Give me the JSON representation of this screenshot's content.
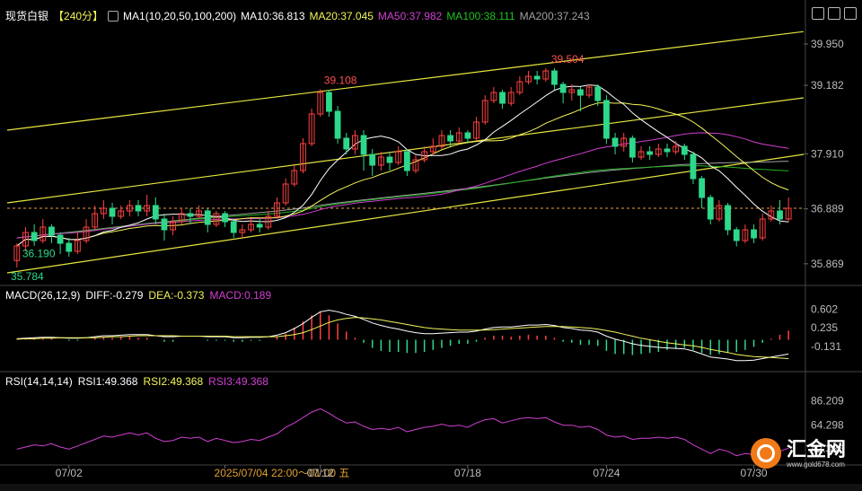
{
  "header": {
    "title": "现货白银",
    "period": "【240分】",
    "ma_label": "MA1(10,20,50,100,200)",
    "ma10": "MA10:36.813",
    "ma20": "MA20:37.045",
    "ma50": "MA50:37.982",
    "ma100": "MA100:38.111",
    "ma200": "MA200:37.243"
  },
  "colors": {
    "up": "#ff4040",
    "down": "#2ed88a",
    "ma10": "#ffffff",
    "ma20": "#f4f45a",
    "ma50": "#d040d0",
    "ma100": "#22b022",
    "ma200": "#a0a0a0",
    "channel": "#e6e640"
  },
  "macd": {
    "label": "MACD(26,12,9)",
    "diff": "DIFF:-0.279",
    "dea": "DEA:-0.373",
    "macd": "MACD:0.189",
    "axis": [
      "0.602",
      "0.235",
      "-0.131"
    ]
  },
  "rsi": {
    "label": "RSI(14,14,14)",
    "rsi1": "RSI1:49.368",
    "rsi2": "RSI2:49.368",
    "rsi3": "RSI3:49.368",
    "axis": [
      "86.209",
      "64.298",
      "42.386"
    ]
  },
  "price_axis": [
    "39.950",
    "39.182",
    "37.910",
    "36.889",
    "35.869"
  ],
  "annotations": {
    "high": "39.504",
    "mid_high": "39.108",
    "low": "36.190",
    "start_low": "35.784"
  },
  "time_axis": [
    "07/02",
    "2025/07/04 22:00～01:00 五",
    "07/12",
    "07/18",
    "07/24",
    "07/30"
  ],
  "logo": {
    "name": "汇金网",
    "url": "www.gold678.com"
  },
  "chart_data": {
    "type": "candlestick",
    "price_ylim": [
      35.5,
      40.3
    ],
    "candles": [
      [
        35.93,
        36.2,
        35.8,
        36.25
      ],
      [
        36.2,
        36.45,
        36.1,
        36.55
      ],
      [
        36.45,
        36.3,
        36.2,
        36.6
      ],
      [
        36.3,
        36.55,
        36.25,
        36.7
      ],
      [
        36.55,
        36.4,
        36.25,
        36.6
      ],
      [
        36.4,
        36.25,
        36.05,
        36.45
      ],
      [
        36.25,
        36.1,
        36.0,
        36.35
      ],
      [
        36.1,
        36.3,
        36.05,
        36.45
      ],
      [
        36.3,
        36.55,
        36.25,
        36.7
      ],
      [
        36.55,
        36.8,
        36.5,
        36.95
      ],
      [
        36.8,
        36.9,
        36.7,
        37.05
      ],
      [
        36.9,
        36.75,
        36.6,
        37.0
      ],
      [
        36.75,
        36.85,
        36.7,
        36.95
      ],
      [
        36.85,
        36.95,
        36.75,
        37.05
      ],
      [
        36.95,
        36.85,
        36.75,
        37.05
      ],
      [
        36.85,
        36.95,
        36.75,
        37.15
      ],
      [
        36.95,
        36.7,
        36.6,
        37.1
      ],
      [
        36.7,
        36.5,
        36.3,
        36.8
      ],
      [
        36.5,
        36.65,
        36.4,
        36.75
      ],
      [
        36.65,
        36.8,
        36.6,
        36.9
      ],
      [
        36.8,
        36.75,
        36.6,
        36.9
      ],
      [
        36.75,
        36.85,
        36.7,
        36.95
      ],
      [
        36.85,
        36.6,
        36.45,
        36.9
      ],
      [
        36.6,
        36.8,
        36.55,
        36.85
      ],
      [
        36.8,
        36.65,
        36.55,
        36.85
      ],
      [
        36.65,
        36.45,
        36.35,
        36.7
      ],
      [
        36.45,
        36.5,
        36.35,
        36.6
      ],
      [
        36.5,
        36.6,
        36.45,
        36.7
      ],
      [
        36.6,
        36.55,
        36.45,
        36.7
      ],
      [
        36.55,
        36.75,
        36.5,
        36.85
      ],
      [
        36.75,
        37.0,
        36.7,
        37.1
      ],
      [
        37.0,
        37.35,
        36.95,
        37.45
      ],
      [
        37.35,
        37.6,
        37.3,
        37.7
      ],
      [
        37.6,
        38.1,
        37.55,
        38.2
      ],
      [
        38.1,
        38.65,
        38.05,
        38.75
      ],
      [
        38.65,
        39.05,
        38.6,
        39.11
      ],
      [
        39.05,
        38.7,
        38.6,
        39.1
      ],
      [
        38.7,
        38.2,
        38.1,
        38.8
      ],
      [
        38.2,
        38.0,
        37.9,
        38.3
      ],
      [
        38.0,
        38.25,
        37.9,
        38.35
      ],
      [
        38.25,
        37.9,
        37.6,
        38.35
      ],
      [
        37.9,
        37.7,
        37.5,
        38.0
      ],
      [
        37.7,
        37.85,
        37.6,
        37.95
      ],
      [
        37.85,
        37.75,
        37.6,
        37.95
      ],
      [
        37.75,
        37.95,
        37.7,
        38.05
      ],
      [
        37.95,
        37.6,
        37.5,
        38.0
      ],
      [
        37.6,
        37.8,
        37.55,
        37.9
      ],
      [
        37.8,
        37.95,
        37.75,
        38.05
      ],
      [
        37.95,
        38.05,
        37.9,
        38.2
      ],
      [
        38.05,
        38.25,
        38.0,
        38.35
      ],
      [
        38.25,
        38.15,
        38.05,
        38.35
      ],
      [
        38.15,
        38.3,
        38.1,
        38.4
      ],
      [
        38.3,
        38.2,
        38.1,
        38.35
      ],
      [
        38.2,
        38.5,
        38.15,
        38.6
      ],
      [
        38.5,
        38.9,
        38.45,
        39.0
      ],
      [
        38.9,
        39.05,
        38.85,
        39.15
      ],
      [
        39.05,
        38.85,
        38.75,
        39.1
      ],
      [
        38.85,
        39.05,
        38.8,
        39.15
      ],
      [
        39.05,
        39.25,
        39.0,
        39.35
      ],
      [
        39.25,
        39.35,
        39.2,
        39.45
      ],
      [
        39.35,
        39.3,
        39.2,
        39.45
      ],
      [
        39.3,
        39.45,
        39.25,
        39.5
      ],
      [
        39.45,
        39.2,
        39.1,
        39.5
      ],
      [
        39.2,
        39.05,
        38.85,
        39.25
      ],
      [
        39.05,
        39.1,
        38.9,
        39.2
      ],
      [
        39.1,
        39.0,
        38.7,
        39.15
      ],
      [
        39.0,
        39.15,
        38.95,
        39.2
      ],
      [
        39.15,
        38.9,
        38.8,
        39.2
      ],
      [
        38.9,
        38.2,
        38.1,
        39.0
      ],
      [
        38.2,
        38.05,
        37.9,
        38.3
      ],
      [
        38.05,
        38.2,
        37.95,
        38.3
      ],
      [
        38.2,
        37.85,
        37.75,
        38.25
      ],
      [
        37.85,
        37.95,
        37.8,
        38.05
      ],
      [
        37.95,
        37.9,
        37.8,
        38.05
      ],
      [
        37.9,
        38.0,
        37.85,
        38.1
      ],
      [
        38.0,
        37.95,
        37.85,
        38.1
      ],
      [
        37.95,
        38.05,
        37.9,
        38.15
      ],
      [
        38.05,
        37.9,
        37.8,
        38.1
      ],
      [
        37.9,
        37.45,
        37.35,
        37.95
      ],
      [
        37.45,
        37.1,
        36.9,
        37.5
      ],
      [
        37.1,
        36.7,
        36.6,
        37.15
      ],
      [
        36.7,
        36.95,
        36.65,
        37.05
      ],
      [
        36.95,
        36.5,
        36.4,
        37.0
      ],
      [
        36.5,
        36.3,
        36.19,
        36.55
      ],
      [
        36.3,
        36.5,
        36.25,
        36.6
      ],
      [
        36.5,
        36.35,
        36.25,
        36.6
      ],
      [
        36.35,
        36.7,
        36.3,
        36.8
      ],
      [
        36.7,
        36.85,
        36.65,
        36.95
      ],
      [
        36.85,
        36.7,
        36.6,
        37.05
      ],
      [
        36.7,
        36.9,
        36.65,
        37.1
      ]
    ],
    "rsi_ylim": [
      30,
      95
    ],
    "rsi_values": [
      42,
      44,
      46,
      45,
      47,
      44,
      42,
      45,
      48,
      51,
      54,
      53,
      55,
      57,
      55,
      57,
      52,
      49,
      50,
      53,
      52,
      53,
      49,
      52,
      50,
      48,
      49,
      51,
      50,
      53,
      56,
      62,
      66,
      71,
      76,
      79,
      75,
      70,
      66,
      67,
      63,
      60,
      61,
      60,
      62,
      58,
      60,
      62,
      63,
      65,
      63,
      64,
      62,
      66,
      69,
      70,
      66,
      68,
      70,
      71,
      70,
      71,
      67,
      64,
      64,
      62,
      63,
      60,
      55,
      53,
      54,
      51,
      52,
      52,
      53,
      52,
      53,
      51,
      46,
      42,
      38,
      42,
      40,
      36,
      38,
      37,
      40,
      42,
      40,
      43
    ],
    "macd_ylim": [
      -0.45,
      0.75
    ],
    "macd_diff": [
      0.02,
      0.03,
      0.04,
      0.05,
      0.05,
      0.04,
      0.03,
      0.03,
      0.04,
      0.06,
      0.08,
      0.08,
      0.09,
      0.1,
      0.1,
      0.1,
      0.08,
      0.06,
      0.06,
      0.07,
      0.07,
      0.07,
      0.06,
      0.06,
      0.06,
      0.04,
      0.04,
      0.05,
      0.05,
      0.06,
      0.09,
      0.14,
      0.22,
      0.32,
      0.44,
      0.55,
      0.58,
      0.55,
      0.5,
      0.46,
      0.4,
      0.33,
      0.28,
      0.24,
      0.21,
      0.17,
      0.14,
      0.12,
      0.12,
      0.13,
      0.14,
      0.15,
      0.15,
      0.17,
      0.21,
      0.24,
      0.25,
      0.25,
      0.27,
      0.29,
      0.29,
      0.3,
      0.28,
      0.24,
      0.22,
      0.19,
      0.18,
      0.15,
      0.07,
      0.01,
      -0.03,
      -0.08,
      -0.11,
      -0.13,
      -0.15,
      -0.16,
      -0.17,
      -0.18,
      -0.22,
      -0.28,
      -0.34,
      -0.36,
      -0.38,
      -0.41,
      -0.41,
      -0.4,
      -0.37,
      -0.34,
      -0.31,
      -0.28
    ],
    "macd_dea": [
      0.01,
      0.02,
      0.02,
      0.03,
      0.03,
      0.04,
      0.04,
      0.04,
      0.04,
      0.04,
      0.05,
      0.06,
      0.06,
      0.07,
      0.08,
      0.08,
      0.08,
      0.08,
      0.08,
      0.07,
      0.07,
      0.07,
      0.07,
      0.07,
      0.07,
      0.06,
      0.06,
      0.06,
      0.06,
      0.06,
      0.06,
      0.08,
      0.1,
      0.14,
      0.2,
      0.27,
      0.34,
      0.39,
      0.42,
      0.44,
      0.43,
      0.41,
      0.39,
      0.36,
      0.33,
      0.3,
      0.27,
      0.24,
      0.22,
      0.21,
      0.2,
      0.19,
      0.19,
      0.19,
      0.19,
      0.2,
      0.21,
      0.22,
      0.23,
      0.24,
      0.25,
      0.26,
      0.26,
      0.26,
      0.25,
      0.24,
      0.23,
      0.21,
      0.18,
      0.15,
      0.11,
      0.07,
      0.03,
      0.0,
      -0.03,
      -0.06,
      -0.08,
      -0.1,
      -0.12,
      -0.15,
      -0.19,
      -0.22,
      -0.25,
      -0.29,
      -0.31,
      -0.33,
      -0.34,
      -0.35,
      -0.36,
      -0.37
    ],
    "ma_periods": [
      10,
      20,
      50,
      100,
      200
    ]
  }
}
